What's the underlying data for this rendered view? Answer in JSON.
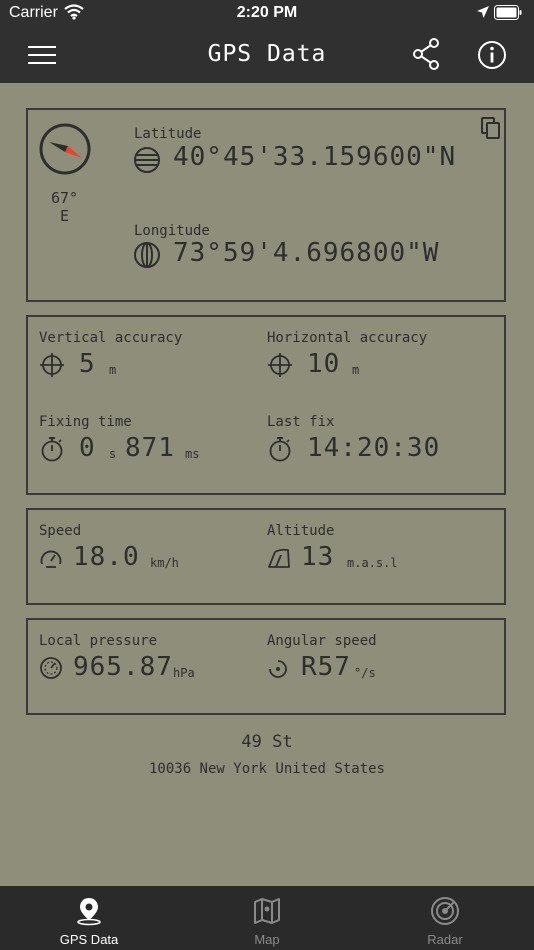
{
  "status_bar": {
    "carrier": "Carrier",
    "time": "2:20 PM"
  },
  "nav": {
    "title": "GPS Data"
  },
  "compass": {
    "degrees": "67°",
    "direction": "E"
  },
  "coordinates": {
    "latitude_label": "Latitude",
    "latitude_value": "40°45'33.159600\"N",
    "longitude_label": "Longitude",
    "longitude_value": "73°59'4.696800\"W"
  },
  "accuracy": {
    "vertical_label": "Vertical accuracy",
    "vertical_value": "5",
    "vertical_unit": "m",
    "horizontal_label": "Horizontal accuracy",
    "horizontal_value": "10",
    "horizontal_unit": "m",
    "fixing_label": "Fixing time",
    "fixing_seconds": "0",
    "fixing_seconds_unit": "s",
    "fixing_ms": "871",
    "fixing_ms_unit": "ms",
    "last_fix_label": "Last fix",
    "last_fix_value": "14:20:30"
  },
  "motion": {
    "speed_label": "Speed",
    "speed_value": "18.0",
    "speed_unit": "km/h",
    "altitude_label": "Altitude",
    "altitude_value": "13",
    "altitude_unit": "m.a.s.l"
  },
  "environment": {
    "pressure_label": "Local pressure",
    "pressure_value": "965.87",
    "pressure_unit": "hPa",
    "angular_label": "Angular speed",
    "angular_value": "R57",
    "angular_unit": "°/s"
  },
  "address": {
    "street": "49 St",
    "city_line": "10036 New York United States"
  },
  "tabs": [
    {
      "label": "GPS Data",
      "active": true,
      "icon": "location-pin-icon"
    },
    {
      "label": "Map",
      "active": false,
      "icon": "map-icon"
    },
    {
      "label": "Radar",
      "active": false,
      "icon": "radar-icon"
    }
  ],
  "colors": {
    "background": "#8f8e7a",
    "bar": "#303030",
    "text": "#2e2e2e",
    "tab_active": "#ffffff",
    "tab_inactive": "#8a8a8a",
    "compass_needle": "#e8442e"
  }
}
